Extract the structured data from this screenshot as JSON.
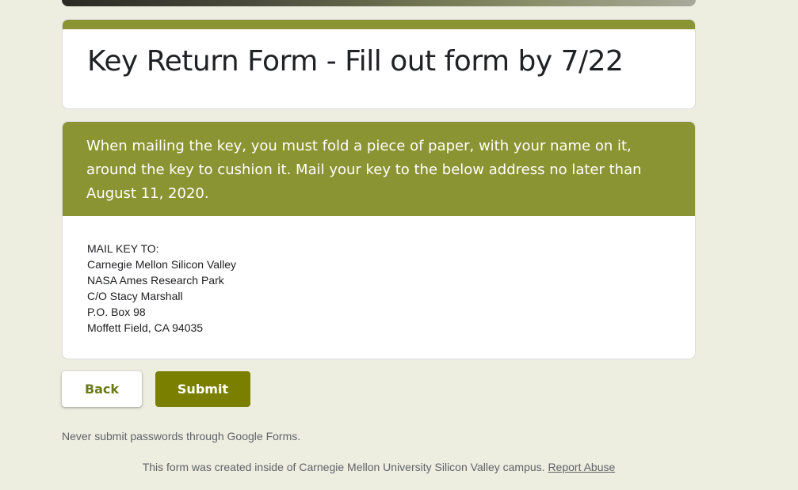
{
  "form": {
    "title": "Key Return Form - Fill out form by 7/22",
    "section_description": "When mailing the key, you must fold a piece of paper, with your name on it, around the key to cushion it. Mail your key to the below address no later than August 11, 2020.",
    "address_lines": [
      "MAIL KEY TO:",
      "Carnegie Mellon Silicon Valley",
      "NASA Ames Research Park",
      "C/O Stacy Marshall",
      "P.O. Box 98",
      "Moffett Field, CA 94035"
    ]
  },
  "buttons": {
    "back_label": "Back",
    "submit_label": "Submit"
  },
  "notices": {
    "password_warning": "Never submit passwords through Google Forms.",
    "footer_text": "This form was created inside of Carnegie Mellon University Silicon Valley campus.",
    "report_abuse": "Report Abuse"
  },
  "colors": {
    "theme": "#8b9432",
    "submit_button": "#7a7f00",
    "background": "#edede0"
  }
}
